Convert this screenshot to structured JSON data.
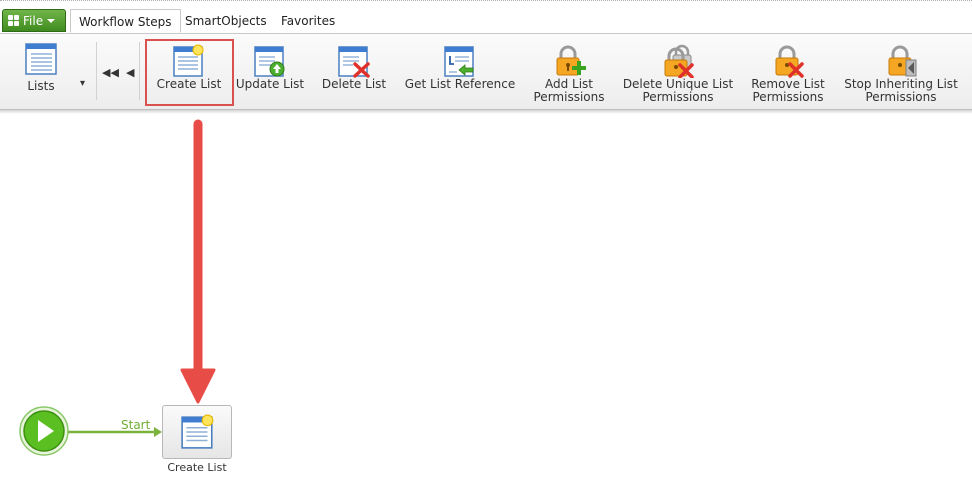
{
  "file_menu": {
    "label": "File"
  },
  "tabs": [
    "Workflow Steps",
    "SmartObjects",
    "Favorites"
  ],
  "ribbon": {
    "lists_label": "Lists",
    "buttons": {
      "create_list": "Create List",
      "update_list": "Update List",
      "delete_list": "Delete List",
      "get_list_reference": "Get List Reference",
      "add_list_permissions": [
        "Add List",
        "Permissions"
      ],
      "delete_unique_list_permissions": [
        "Delete Unique List",
        "Permissions"
      ],
      "remove_list_permissions": [
        "Remove List",
        "Permissions"
      ],
      "stop_inheriting_list_permissions": [
        "Stop Inheriting List",
        "Permissions"
      ]
    }
  },
  "canvas": {
    "start_line_label": "Start",
    "node_label": "Create List"
  },
  "colors": {
    "highlight": "#d9524e",
    "arrow": "#e84c46",
    "start_green": "#5bbf21",
    "file_green": "#4f9a2b"
  }
}
